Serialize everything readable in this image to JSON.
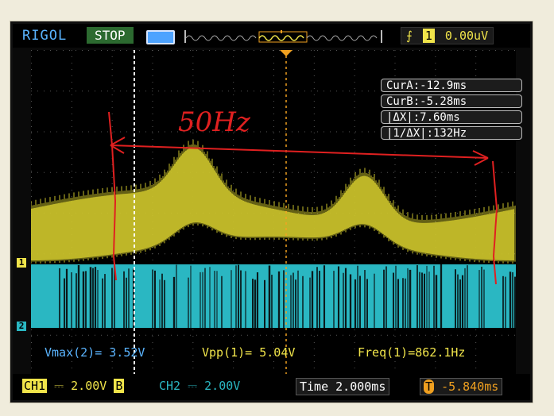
{
  "header": {
    "brand": "RIGOL",
    "status": "STOP",
    "trigger_channel": "1",
    "trigger_level": "0.00uV"
  },
  "cursors": {
    "cura": "CurA:-12.9ms",
    "curb": "CurB:-5.28ms",
    "dx": "|ΔX|:7.60ms",
    "inv_dx": "|1/ΔX|:132Hz"
  },
  "annotation": {
    "handwritten": "50Hz"
  },
  "channel_markers": {
    "ch1": "1",
    "ch2": "2"
  },
  "measurements": {
    "vmax2": "Vmax(2)= 3.52V",
    "vpp1": "Vpp(1)= 5.04V",
    "freq1": "Freq(1)=862.1Hz"
  },
  "bottom": {
    "ch1_label": "CH1",
    "ch1_value": "2.00V",
    "ch1_bw": "B",
    "ch2_label": "CH2",
    "ch2_value": "2.00V",
    "time_label": "Time",
    "time_value": "2.000ms",
    "trig_offset": "-5.840ms"
  },
  "colors": {
    "ch1": "#c8c02a",
    "ch2": "#2ab7c2",
    "cursor": "#ffffff",
    "annotation": "#e02020",
    "ui_blue": "#5ab4ff"
  }
}
